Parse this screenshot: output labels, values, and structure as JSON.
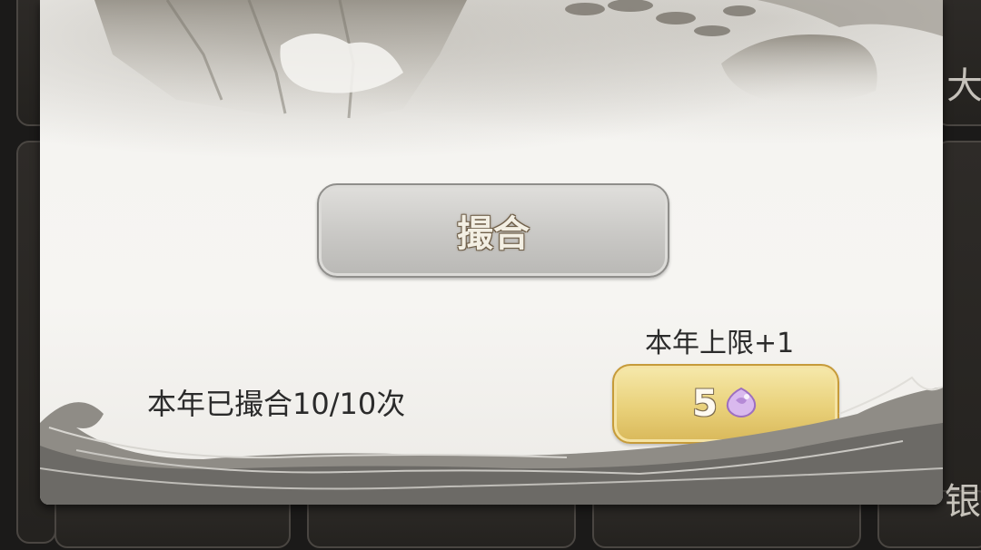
{
  "dialog": {
    "match_button_label": "撮合",
    "match_count_text": "本年已撮合10/10次",
    "limit_increase_text": "本年上限+1",
    "buy_button": {
      "price": "5",
      "currency_icon": "purple-gem-icon"
    }
  },
  "background": {
    "right_glyph_top": "大",
    "right_glyph_bottom": "银"
  },
  "colors": {
    "dialog_bg": "#f5f4f1",
    "gold_button": "#e9d17a",
    "gray_button": "#c9c8c5",
    "text": "#2b2b2b",
    "gem": "#c9a6e0"
  }
}
